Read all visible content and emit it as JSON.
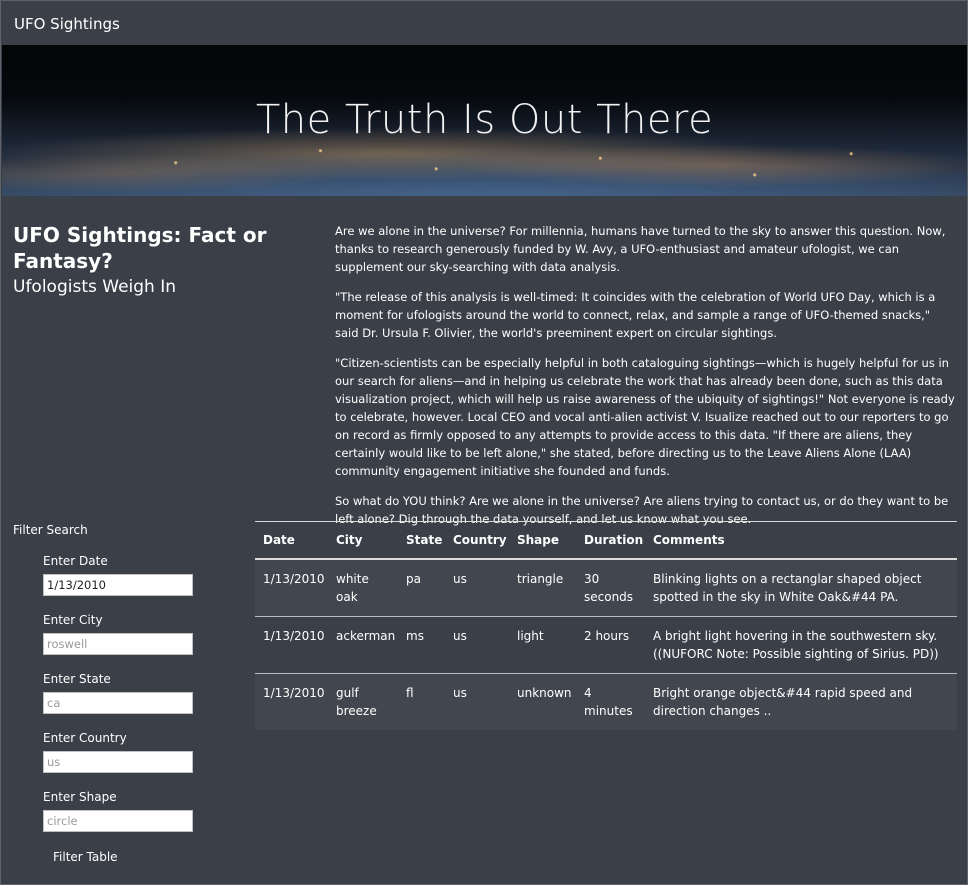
{
  "nav": {
    "brand": "UFO Sightings"
  },
  "hero": {
    "title": "The Truth Is Out There"
  },
  "intro": {
    "heading": "UFO Sightings: Fact or Fantasy?",
    "subheading": "Ufologists Weigh In",
    "paragraphs": [
      "Are we alone in the universe? For millennia, humans have turned to the sky to answer this question. Now, thanks to research generously funded by W. Avy, a UFO-enthusiast and amateur ufologist, we can supplement our sky-searching with data analysis.",
      "\"The release of this analysis is well-timed: It coincides with the celebration of World UFO Day, which is a moment for ufologists around the world to connect, relax, and sample a range of UFO-themed snacks,\" said Dr. Ursula F. Olivier, the world's preeminent expert on circular sightings.",
      "\"Citizen-scientists can be especially helpful in both cataloguing sightings—which is hugely helpful for us in our search for aliens—and in helping us celebrate the work that has already been done, such as this data visualization project, which will help us raise awareness of the ubiquity of sightings!\" Not everyone is ready to celebrate, however. Local CEO and vocal anti-alien activist V. Isualize reached out to our reporters to go on record as firmly opposed to any attempts to provide access to this data. \"If there are aliens, they certainly would like to be left alone,\" she stated, before directing us to the Leave Aliens Alone (LAA) community engagement initiative she founded and funds.",
      "So what do YOU think? Are we alone in the universe? Are aliens trying to contact us, or do they want to be left alone? Dig through the data yourself, and let us know what you see."
    ]
  },
  "filters": {
    "title": "Filter Search",
    "fields": [
      {
        "label": "Enter Date",
        "value": "1/13/2010",
        "placeholder": ""
      },
      {
        "label": "Enter City",
        "value": "",
        "placeholder": "roswell"
      },
      {
        "label": "Enter State",
        "value": "",
        "placeholder": "ca"
      },
      {
        "label": "Enter Country",
        "value": "",
        "placeholder": "us"
      },
      {
        "label": "Enter Shape",
        "value": "",
        "placeholder": "circle"
      }
    ],
    "button_label": "Filter Table"
  },
  "table": {
    "headers": [
      "Date",
      "City",
      "State",
      "Country",
      "Shape",
      "Duration",
      "Comments"
    ],
    "rows": [
      [
        "1/13/2010",
        "white oak",
        "pa",
        "us",
        "triangle",
        "30 seconds",
        "Blinking lights on a rectanglar shaped object spotted in the sky in White Oak&#44 PA."
      ],
      [
        "1/13/2010",
        "ackerman",
        "ms",
        "us",
        "light",
        "2 hours",
        "A bright light hovering in the southwestern sky. ((NUFORC Note: Possible sighting of Sirius. PD))"
      ],
      [
        "1/13/2010",
        "gulf breeze",
        "fl",
        "us",
        "unknown",
        "4 minutes",
        "Bright orange object&#44 rapid speed and direction changes .."
      ]
    ]
  }
}
